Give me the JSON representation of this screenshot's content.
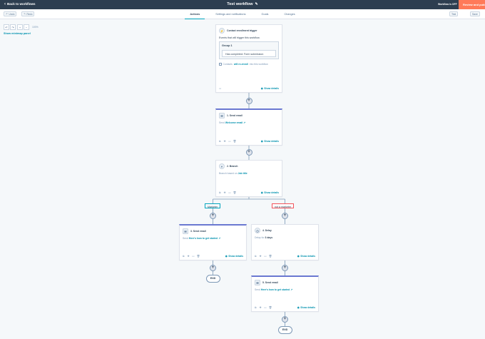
{
  "header": {
    "back_label": "Back to workflows",
    "title": "Test workflow",
    "status": "Workflow is OFF",
    "review_label": "Review and publish"
  },
  "toolbar": {
    "undo_label": "Undo",
    "redo_label": "Redo",
    "tabs": [
      {
        "label": "Actions",
        "active": true
      },
      {
        "label": "Settings and notifications",
        "active": false
      },
      {
        "label": "Goals",
        "active": false
      },
      {
        "label": "Changes",
        "active": false
      }
    ],
    "right_btn_1": "Test",
    "right_btn_2": "Save"
  },
  "canvas": {
    "zoom": "100%",
    "minimap_label": "Show minimap panel"
  },
  "trigger": {
    "title": "Contact enrollment trigger",
    "subtitle": "Events that will trigger this workflow.",
    "group_title": "Group 1",
    "group_item": "Has completed: Form submission",
    "enroll_pre": "Contacts",
    "enroll_link": "will re-enroll",
    "enroll_post": "into this workflow",
    "show_details": "Show details"
  },
  "actions": [
    {
      "title": "1. Send email",
      "body_pre": "Send",
      "body_link": "Welcome email",
      "show_details": "Show details"
    },
    {
      "title": "2. Branch",
      "body_pre": "Branch based on",
      "body_link": "Job title",
      "show_details": "Show details"
    },
    {
      "title": "3. Send email",
      "body_pre": "Send",
      "body_link": "Here's how to get started",
      "show_details": "Show details"
    },
    {
      "title": "4. Delay",
      "body_pre": "Delay for",
      "body_link": "3 days",
      "show_details": "Show details"
    },
    {
      "title": "5. Send email",
      "body_pre": "Send",
      "body_link": "Here's how to get started",
      "show_details": "Show details"
    }
  ],
  "branches": {
    "left": "Marketer",
    "right": "not a marketer"
  },
  "end_label": "END",
  "colors": {
    "header_bg": "#2d3e50",
    "accent_orange": "#ff7a59",
    "link_teal": "#0091ae",
    "action_border": "#6a78d1"
  }
}
